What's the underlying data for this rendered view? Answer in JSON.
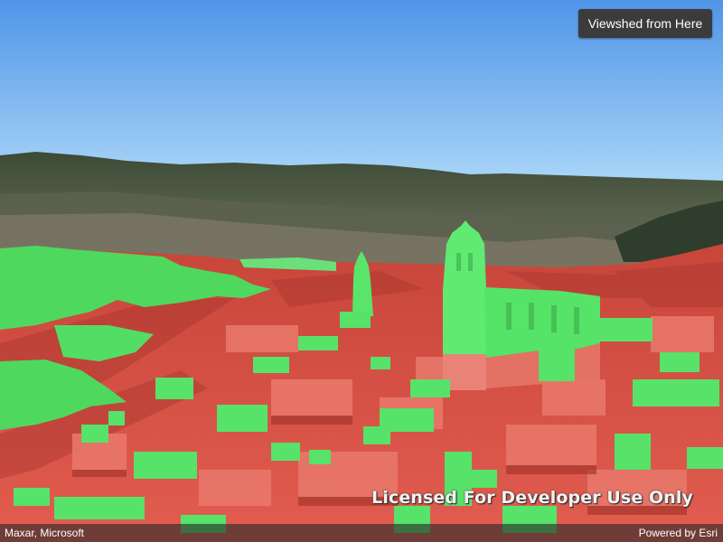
{
  "toolbar": {
    "viewshed_button_label": "Viewshed from Here"
  },
  "watermark": {
    "text": "Licensed For Developer Use Only"
  },
  "attribution": {
    "left": "Maxar, Microsoft",
    "right": "Powered by Esri"
  },
  "colors": {
    "visible": "#55e86a",
    "not_visible": "#e35a4c",
    "sky_top": "#4f95e8",
    "sky_bottom": "#a7d3f7"
  }
}
